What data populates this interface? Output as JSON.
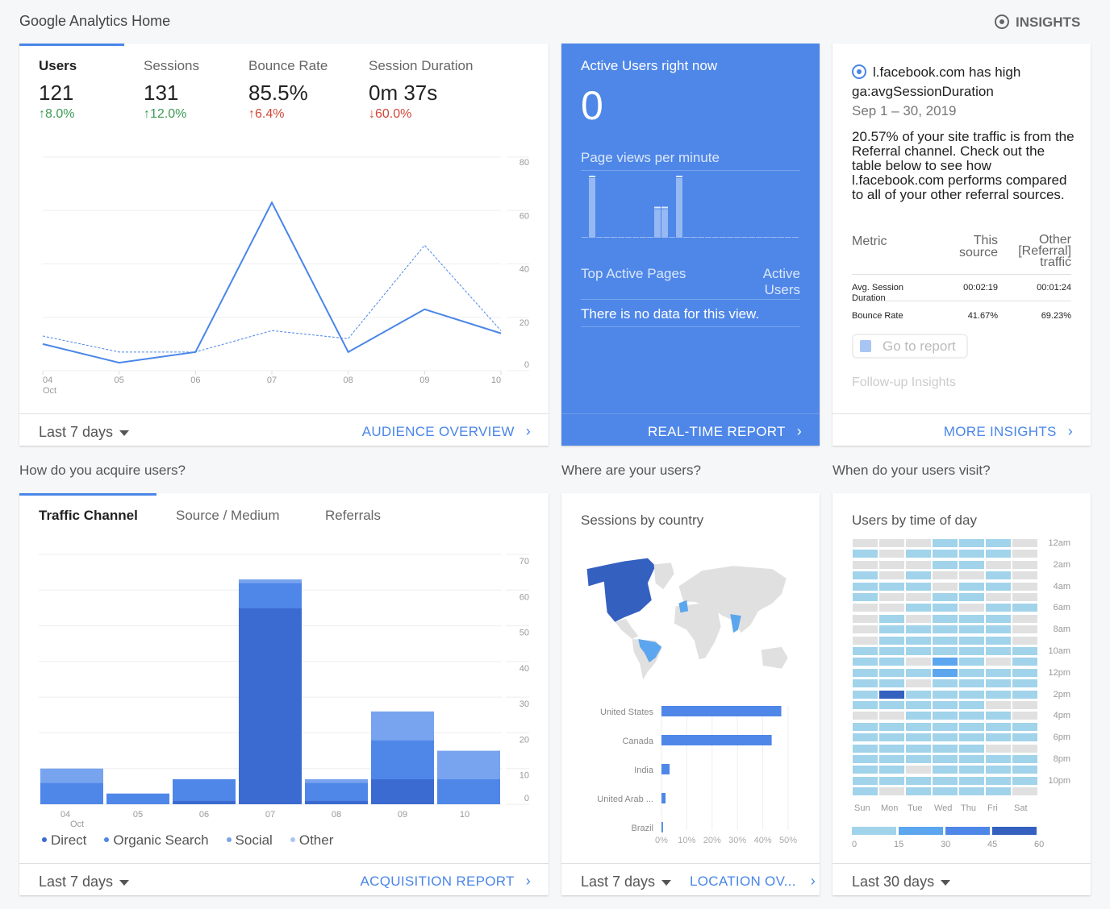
{
  "page_title": "Google Analytics Home",
  "insights_label": "INSIGHTS",
  "colors": {
    "accent": "#4a86e8",
    "realtime_bg": "#4f87e8",
    "positive": "#3c9a52",
    "negative": "#d2463a"
  },
  "audience": {
    "metrics": [
      {
        "label": "Users",
        "value": "121",
        "change": "↑8.0%",
        "trend": "good"
      },
      {
        "label": "Sessions",
        "value": "131",
        "change": "↑12.0%",
        "trend": "good"
      },
      {
        "label": "Bounce Rate",
        "value": "85.5%",
        "change": "↑6.4%",
        "trend": "bad"
      },
      {
        "label": "Session Duration",
        "value": "0m 37s",
        "change": "↓60.0%",
        "trend": "bad"
      }
    ],
    "date_range": "Last 7 days",
    "link": "AUDIENCE OVERVIEW"
  },
  "realtime": {
    "title": "Active Users right now",
    "active_users": "0",
    "pageviews_label": "Page views per minute",
    "pageviews_per_minute": [
      0,
      2,
      0,
      0,
      0,
      0,
      0,
      0,
      0,
      0,
      1,
      1,
      0,
      2,
      0,
      0,
      0,
      0,
      0,
      0,
      0,
      0,
      0,
      0,
      0,
      0,
      0,
      0,
      0,
      0
    ],
    "top_pages_label": "Top Active Pages",
    "active_users_col": "Active Users",
    "empty_message": "There is no data for this view.",
    "link": "REAL-TIME REPORT"
  },
  "insight": {
    "headline": "l.facebook.com has high ga:avgSessionDuration",
    "date": "Sep 1 – 30, 2019",
    "body": "20.57% of your site traffic is from the Referral channel. Check out the table below to see how l.facebook.com performs compared to all of your other referral sources.",
    "table": {
      "headers": [
        "Metric",
        "This source",
        "Other [Referral] traffic"
      ],
      "rows": [
        [
          "Avg. Session Duration",
          "00:02:19",
          "00:01:24"
        ],
        [
          "Bounce Rate",
          "41.67%",
          "69.23%"
        ]
      ]
    },
    "go_to_report": "Go to report",
    "follow_up": "Follow-up Insights",
    "link": "MORE INSIGHTS"
  },
  "acquisition": {
    "section_title": "How do you acquire users?",
    "tabs": [
      "Traffic Channel",
      "Source / Medium",
      "Referrals"
    ],
    "date_range": "Last 7 days",
    "link": "ACQUISITION REPORT"
  },
  "location": {
    "section_title": "Where are your users?",
    "card_title": "Sessions by country",
    "date_range": "Last 7 days",
    "link": "LOCATION OV..."
  },
  "time_of_day": {
    "section_title": "When do your users visit?",
    "card_title": "Users by time of day",
    "date_range": "Last 30 days"
  },
  "chart_data": [
    {
      "type": "line",
      "categories": [
        "04",
        "05",
        "06",
        "07",
        "08",
        "09",
        "10"
      ],
      "x_sublabel": "Oct",
      "ylim": [
        0,
        80
      ],
      "yticks": [
        "0",
        "20",
        "40",
        "60",
        "80"
      ],
      "series": [
        {
          "style": "solid",
          "values": [
            10,
            3,
            7,
            63,
            7,
            23,
            14
          ]
        },
        {
          "style": "dashed",
          "values": [
            13,
            7,
            7,
            15,
            12,
            47,
            15
          ]
        }
      ],
      "grid": true
    },
    {
      "type": "bar",
      "stacked": true,
      "categories": [
        "04",
        "05",
        "06",
        "07",
        "08",
        "09",
        "10"
      ],
      "x_sublabel": "Oct",
      "ylim": [
        0,
        70
      ],
      "yticks": [
        "0",
        "10",
        "20",
        "30",
        "40",
        "50",
        "60",
        "70"
      ],
      "series": [
        {
          "name": "Direct",
          "color": "#3b6bd1",
          "values": [
            0,
            0,
            1,
            55,
            1,
            7,
            0
          ]
        },
        {
          "name": "Organic Search",
          "color": "#4f87e8",
          "values": [
            6,
            3,
            6,
            7,
            5,
            11,
            7
          ]
        },
        {
          "name": "Social",
          "color": "#78a3ee",
          "values": [
            4,
            0,
            0,
            1,
            1,
            8,
            8
          ]
        },
        {
          "name": "Other",
          "color": "#a9c5f4",
          "values": [
            0,
            0,
            0,
            0,
            0,
            0,
            0
          ]
        }
      ],
      "legend": "bottom"
    },
    {
      "type": "bar",
      "orientation": "horizontal",
      "categories": [
        "United States",
        "Canada",
        "India",
        "United Arab ...",
        "Brazil"
      ],
      "values": [
        47.3,
        43.5,
        3.2,
        1.6,
        0.6
      ],
      "xlim": [
        0,
        50
      ],
      "xticks": [
        "0%",
        "10%",
        "20%",
        "30%",
        "40%",
        "50%"
      ]
    },
    {
      "type": "heatmap",
      "columns": [
        "Sun",
        "Mon",
        "Tue",
        "Wed",
        "Thu",
        "Fri",
        "Sat"
      ],
      "row_labels": [
        "12am",
        "2am",
        "4am",
        "6am",
        "8am",
        "10am",
        "12pm",
        "2pm",
        "4pm",
        "6pm",
        "8pm",
        "10pm"
      ],
      "legend_ticks": [
        "0",
        "15",
        "30",
        "45",
        "60"
      ],
      "legend_colors": [
        "#a1d3ea",
        "#5ba6ee",
        "#4f87e8",
        "#3460c0"
      ],
      "empty_color": "#e0e0e0",
      "levels_by_hour": [
        [
          0,
          0,
          0,
          1,
          1,
          1,
          0
        ],
        [
          1,
          0,
          1,
          1,
          1,
          1,
          0
        ],
        [
          0,
          0,
          0,
          1,
          1,
          0,
          0
        ],
        [
          1,
          0,
          1,
          0,
          0,
          1,
          0
        ],
        [
          1,
          1,
          1,
          0,
          1,
          1,
          0
        ],
        [
          1,
          0,
          0,
          1,
          1,
          0,
          0
        ],
        [
          0,
          0,
          1,
          1,
          0,
          1,
          1
        ],
        [
          0,
          1,
          0,
          1,
          1,
          1,
          0
        ],
        [
          0,
          1,
          1,
          1,
          1,
          1,
          0
        ],
        [
          0,
          1,
          1,
          1,
          1,
          1,
          0
        ],
        [
          1,
          1,
          1,
          1,
          1,
          1,
          1
        ],
        [
          1,
          1,
          0,
          2,
          1,
          0,
          1
        ],
        [
          1,
          1,
          1,
          2,
          1,
          1,
          1
        ],
        [
          1,
          1,
          0,
          1,
          1,
          1,
          1
        ],
        [
          1,
          4,
          1,
          1,
          1,
          1,
          1
        ],
        [
          1,
          1,
          1,
          1,
          1,
          0,
          0
        ],
        [
          0,
          0,
          1,
          1,
          1,
          1,
          0
        ],
        [
          1,
          1,
          1,
          1,
          1,
          1,
          1
        ],
        [
          1,
          1,
          1,
          1,
          1,
          1,
          1
        ],
        [
          1,
          1,
          1,
          1,
          1,
          0,
          0
        ],
        [
          1,
          1,
          1,
          1,
          1,
          1,
          1
        ],
        [
          1,
          1,
          0,
          1,
          1,
          1,
          1
        ],
        [
          1,
          1,
          1,
          1,
          1,
          1,
          1
        ],
        [
          1,
          0,
          1,
          1,
          1,
          1,
          0
        ]
      ]
    }
  ]
}
